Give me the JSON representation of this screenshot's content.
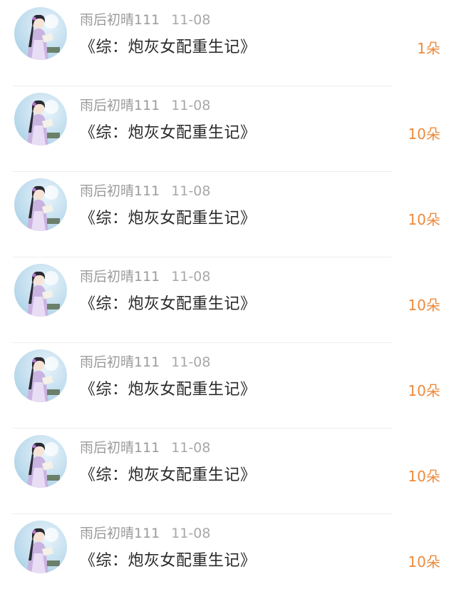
{
  "colors": {
    "accent": "#ee8a3c",
    "meta_text": "#9a9a9a",
    "title_text": "#2a2a2a"
  },
  "items": [
    {
      "author": "雨后初晴111",
      "date": "11-08",
      "title": "《综：炮灰女配重生记》",
      "count": "1朵"
    },
    {
      "author": "雨后初晴111",
      "date": "11-08",
      "title": "《综：炮灰女配重生记》",
      "count": "10朵"
    },
    {
      "author": "雨后初晴111",
      "date": "11-08",
      "title": "《综：炮灰女配重生记》",
      "count": "10朵"
    },
    {
      "author": "雨后初晴111",
      "date": "11-08",
      "title": "《综：炮灰女配重生记》",
      "count": "10朵"
    },
    {
      "author": "雨后初晴111",
      "date": "11-08",
      "title": "《综：炮灰女配重生记》",
      "count": "10朵"
    },
    {
      "author": "雨后初晴111",
      "date": "11-08",
      "title": "《综：炮灰女配重生记》",
      "count": "10朵"
    },
    {
      "author": "雨后初晴111",
      "date": "11-08",
      "title": "《综：炮灰女配重生记》",
      "count": "10朵"
    }
  ]
}
